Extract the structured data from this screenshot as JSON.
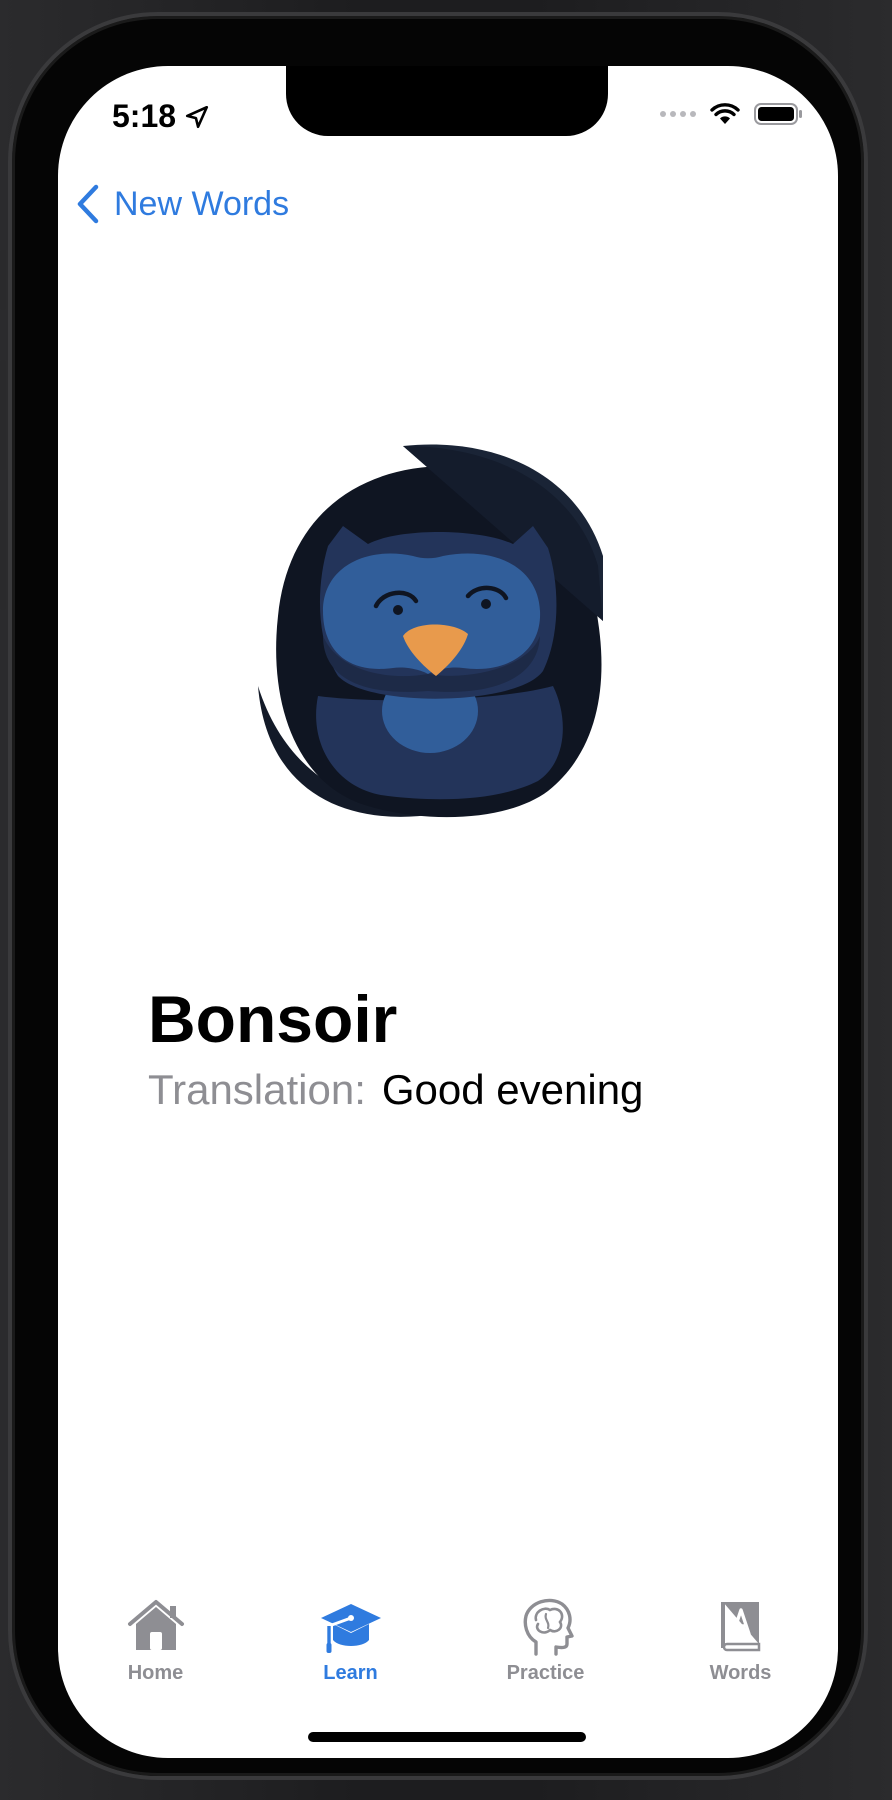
{
  "status_bar": {
    "time": "5:18",
    "icons": [
      "location-arrow-icon",
      "signal-dots-icon",
      "wifi-icon",
      "battery-icon"
    ]
  },
  "nav": {
    "back_label": "New Words",
    "back_icon": "chevron-left-icon"
  },
  "card": {
    "mascot": "owl-mascot-icon",
    "word": "Bonsoir",
    "translation_label": "Translation:",
    "translation_value": "Good evening"
  },
  "tabbar": {
    "tabs": [
      {
        "label": "Home",
        "icon": "house-icon"
      },
      {
        "label": "Learn",
        "icon": "graduation-cap-icon",
        "active": true
      },
      {
        "label": "Practice",
        "icon": "brain-head-icon"
      },
      {
        "label": "Words",
        "icon": "dictionary-book-icon"
      }
    ]
  },
  "colors": {
    "accent": "#2f7bdf",
    "inactive": "#8e8e93",
    "owl_dark": "#131a28",
    "owl_mid": "#23345a",
    "owl_light": "#315e9a",
    "beak": "#e89a4c"
  }
}
